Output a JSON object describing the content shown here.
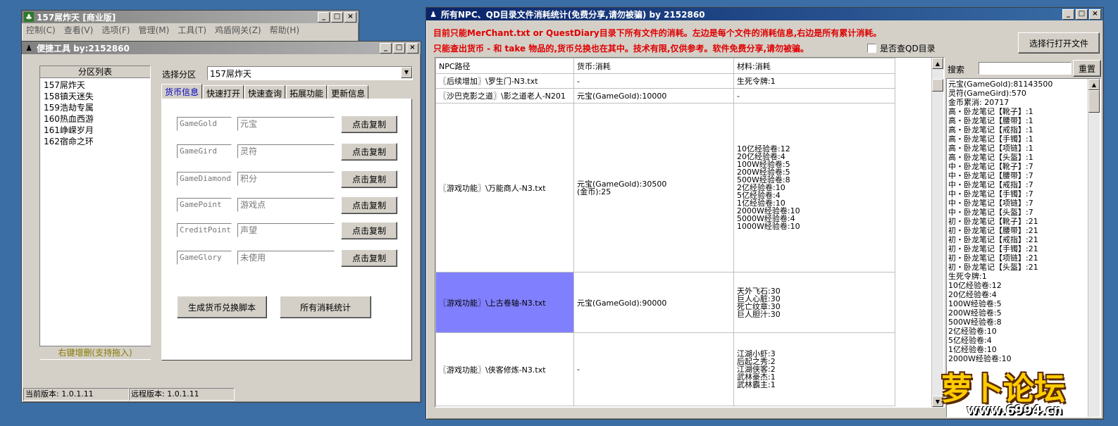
{
  "win1": {
    "title": "157屌炸天 [商业版]",
    "menu": [
      "控制(C)",
      "查看(V)",
      "选项(F)",
      "管理(M)",
      "工具(T)",
      "鸡盾网关(Z)",
      "帮助(H)"
    ]
  },
  "win2": {
    "title": "便捷工具   by:2152860",
    "partition_list_header": "分区列表",
    "partitions": [
      "157屌炸天",
      "158镇天迷失",
      "159浩劫专属",
      "160热血西游",
      "161峥嵘岁月",
      "162宿命之环"
    ],
    "partition_hint": "右键增删(支持拖入)",
    "select_label": "选择分区",
    "select_value": "157屌炸天",
    "tabs": [
      "货币信息",
      "快速打开",
      "快速查询",
      "拓展功能",
      "更新信息"
    ],
    "currencies": [
      {
        "code": "GameGold",
        "name": "元宝",
        "button": "点击复制"
      },
      {
        "code": "GameGird",
        "name": "灵符",
        "button": "点击复制"
      },
      {
        "code": "GameDiamond",
        "name": "积分",
        "button": "点击复制"
      },
      {
        "code": "GamePoint",
        "name": "游戏点",
        "button": "点击复制"
      },
      {
        "code": "CreditPoint",
        "name": "声望",
        "button": "点击复制"
      },
      {
        "code": "GameGlory",
        "name": "未使用",
        "button": "点击复制"
      }
    ],
    "gen_button": "生成货币兑换脚本",
    "stats_button": "所有消耗统计",
    "status_current": "当前版本: 1.0.1.11",
    "status_remote": "远程版本: 1.0.1.11"
  },
  "win3": {
    "title": "所有NPC、QD目录文件消耗统计(免费分享,请勿被骗)      by 2152860",
    "notice1": "目前只能MerChant.txt or QuestDiary目录下所有文件的消耗。左边是每个文件的消耗信息,右边是所有累计消耗。",
    "notice2": "只能查出货币 - 和 take 物品的,货币兑换也在其中。技术有限,仅供参考。软件免费分享,请勿被骗。",
    "checkbox_label": "是否查QD目录",
    "open_button": "选择行打开文件",
    "search_label": "搜索",
    "reset_button": "重置",
    "columns": [
      "NPC路径",
      "货币:消耗",
      "材料:消耗"
    ],
    "rows": [
      {
        "path": "〖后续增加〗\\罗生门-N3.txt",
        "currency": [
          "-"
        ],
        "materials": [
          "生死令牌:1"
        ],
        "selected": false
      },
      {
        "path": "〖沙巴克影之道〗\\影之道老人-N201",
        "currency": [
          "元宝(GameGold):10000"
        ],
        "materials": [
          "-"
        ],
        "selected": false
      },
      {
        "path": "〖游戏功能〗\\万能商人-N3.txt",
        "currency": [
          "元宝(GameGold):30500",
          "(金币):25"
        ],
        "materials": [
          "10亿经验卷:12",
          "20亿经验卷:4",
          "100W经验卷:5",
          "200W经验卷:5",
          "500W经验卷:8",
          "2亿经验卷:10",
          "5亿经验卷:4",
          "1亿经验卷:10",
          "2000W经验卷:10",
          "5000W经验卷:4",
          "1000W经验卷:10"
        ],
        "selected": false
      },
      {
        "path": "〖游戏功能〗\\上古卷轴-N3.txt",
        "currency": [
          "元宝(GameGold):90000"
        ],
        "materials": [
          "天外飞石:30",
          "巨人心脏:30",
          "死亡纹章:30",
          "巨人胆汁:30"
        ],
        "selected": true
      },
      {
        "path": "〖游戏功能〗\\侠客修炼-N3.txt",
        "currency": [
          "-"
        ],
        "materials": [
          "江湖小虾:3",
          "后起之秀:2",
          "江湖侠客:2",
          "武林豪杰:1",
          "武林霸主:1"
        ],
        "selected": false
      }
    ],
    "totals": [
      "元宝(GameGold):81143500",
      "灵符(GameGird):570",
      "金币累消: 20717",
      "高・卧龙笔记【靴子】:1",
      "高・卧龙笔记【腰带】:1",
      "高・卧龙笔记【戒指】:1",
      "高・卧龙笔记【手镯】:1",
      "高・卧龙笔记【项链】:1",
      "高・卧龙笔记【头盔】:1",
      "中・卧龙笔记【靴子】:7",
      "中・卧龙笔记【腰带】:7",
      "中・卧龙笔记【戒指】:7",
      "中・卧龙笔记【手镯】:7",
      "中・卧龙笔记【项链】:7",
      "中・卧龙笔记【头盔】:7",
      "初・卧龙笔记【靴子】:21",
      "初・卧龙笔记【腰带】:21",
      "初・卧龙笔记【戒指】:21",
      "初・卧龙笔记【手镯】:21",
      "初・卧龙笔记【项链】:21",
      "初・卧龙笔记【头盔】:21",
      "生死令牌:1",
      "10亿经验卷:12",
      "20亿经验卷:4",
      "100W经验卷:5",
      "200W经验卷:5",
      "500W经验卷:8",
      "2亿经验卷:10",
      "5亿经验卷:4",
      "1亿经验卷:10",
      "2000W经验卷:10"
    ]
  },
  "watermark": {
    "text": "萝卜论坛",
    "url": "www.6994.cn"
  },
  "colors": {
    "selected_row": "#8080ff",
    "notice": "#e00000",
    "titlebar_active": "#0a246a"
  }
}
